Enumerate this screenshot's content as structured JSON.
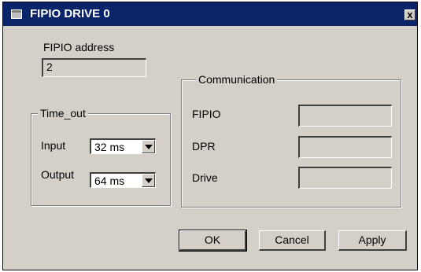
{
  "window": {
    "title": "FIPIO DRIVE 0",
    "close_label": "x"
  },
  "address": {
    "label": "FIPIO address",
    "value": "2"
  },
  "timeout": {
    "legend": "Time_out",
    "input_label": "Input",
    "input_value": "32 ms",
    "output_label": "Output",
    "output_value": "64 ms"
  },
  "communication": {
    "legend": "Communication",
    "fipio_label": "FIPIO",
    "dpr_label": "DPR",
    "drive_label": "Drive"
  },
  "buttons": {
    "ok": "OK",
    "cancel": "Cancel",
    "apply": "Apply"
  }
}
